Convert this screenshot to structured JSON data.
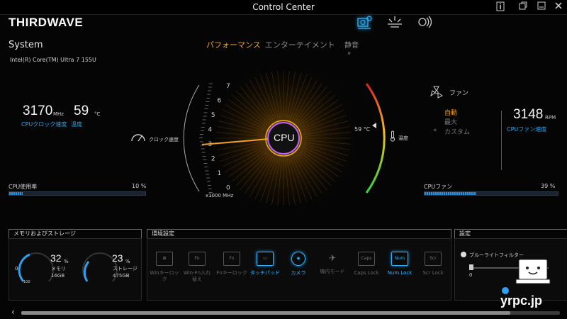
{
  "window": {
    "title": "Control Center"
  },
  "brand": {
    "logo_text": "THIRDWAVE"
  },
  "top_tabs": [
    {
      "icon": "system-icon",
      "active": true
    },
    {
      "icon": "brightness-icon",
      "active": false
    },
    {
      "icon": "wireless-icon",
      "active": false
    }
  ],
  "system": {
    "title": "System",
    "cpu_model": "Intel(R) Core(TM) Ultra 7 155U"
  },
  "modes": {
    "performance": "パフォーマンス",
    "entertainment": "エンターテイメント",
    "quiet": "静音",
    "chevron": "»"
  },
  "cpu": {
    "clock_value": "3170",
    "clock_unit": "MHz",
    "clock_caption": "CPUクロック速度",
    "temp_value": "59",
    "temp_unit": "°C",
    "temp_caption": "温度",
    "usage_label": "CPU使用率",
    "usage_percent": 10,
    "usage_text": "10 %"
  },
  "gauge": {
    "center_label": "CPU",
    "ticks": [
      "7",
      "6",
      "5",
      "4",
      "3",
      "2",
      "1",
      "0"
    ],
    "axis_unit": "x1000 MHz",
    "clock_label": "クロック速度",
    "temp_readout": "59 °C",
    "temp_label": "温度"
  },
  "fan": {
    "title": "ファン",
    "mode_auto": "自動",
    "mode_max": "最大",
    "mode_custom": "カスタム",
    "rpm_value": "3148",
    "rpm_unit": "RPM",
    "rpm_caption": "CPUファン速度",
    "usage_label": "CPUファン",
    "usage_percent": 39,
    "usage_text": "39 %"
  },
  "memory_storage": {
    "title": "メモリおよびストレージ",
    "memory_percent": "32",
    "memory_label": "メモリ",
    "memory_size": "16GB",
    "storage_percent": "23",
    "storage_label": "ストレージ",
    "storage_size": "475GB",
    "pct_unit": "%",
    "gauge_min": "0",
    "gauge_max": "100"
  },
  "environment": {
    "title": "環境設定",
    "items": [
      {
        "label": "Winキーロック",
        "icon_text": "",
        "on": false
      },
      {
        "label": "Win-Fn入れ替え",
        "icon_text": "Fn",
        "on": false
      },
      {
        "label": "Fnキーロック",
        "icon_text": "Fn",
        "on": false
      },
      {
        "label": "タッチパッド",
        "icon_text": "",
        "on": true
      },
      {
        "label": "カメラ",
        "icon_text": "",
        "on": true
      },
      {
        "label": "機内モード",
        "icon_text": "",
        "on": false
      },
      {
        "label": "Caps Lock",
        "icon_text": "Caps",
        "on": false
      },
      {
        "label": "Num Lock",
        "icon_text": "Num",
        "on": true
      },
      {
        "label": "Scr Lock",
        "icon_text": "Scr",
        "on": false
      }
    ]
  },
  "settings": {
    "title": "設定",
    "blue_light_label": "ブルーライトフィルター",
    "slider_min": "0"
  },
  "watermark": "yrpc.jp",
  "colors": {
    "accent": "#2fa6ef",
    "performance": "#f0a020",
    "background": "#050505"
  }
}
